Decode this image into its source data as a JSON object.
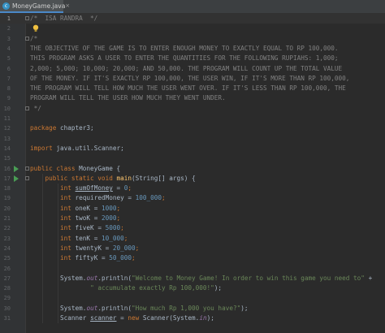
{
  "editor": {
    "tab": {
      "filename": "MoneyGame.java",
      "close": "×"
    },
    "lines": [
      {
        "num": "1",
        "current": true,
        "tokens": [
          {
            "t": "/*  ISA RANDRA  */",
            "c": "comment"
          }
        ]
      },
      {
        "num": "2",
        "bulb": true,
        "tokens": []
      },
      {
        "num": "3",
        "tokens": [
          {
            "t": "/*",
            "c": "comment"
          }
        ]
      },
      {
        "num": "4",
        "tokens": [
          {
            "t": "THE OBJECTIVE OF THE GAME IS TO ENTER ENOUGH MONEY TO EXACTLY EQUAL TO RP 100,000.",
            "c": "comment"
          }
        ]
      },
      {
        "num": "5",
        "tokens": [
          {
            "t": "THIS PROGRAM ASKS A USER TO ENTER THE QUANTITIES FOR THE FOLLOWING RUPIAHS: 1,000;",
            "c": "comment"
          }
        ]
      },
      {
        "num": "6",
        "tokens": [
          {
            "t": "2,000; 5,000; 10,000; 20,000; AND 50,000. THE PROGRAM WILL COUNT UP THE TOTAL VALUE",
            "c": "comment"
          }
        ]
      },
      {
        "num": "7",
        "tokens": [
          {
            "t": "OF THE MONEY. IF IT'S EXACTLY RP 100,000, THE USER WIN, IF IT'S MORE THAN RP 100,000,",
            "c": "comment"
          }
        ]
      },
      {
        "num": "8",
        "tokens": [
          {
            "t": "THE PROGRAM WILL TELL HOW MUCH THE USER WENT OVER. IF IT'S LESS THAN RP 100,000, THE",
            "c": "comment"
          }
        ]
      },
      {
        "num": "9",
        "tokens": [
          {
            "t": "PROGRAM WILL TELL THE USER HOW MUCH THEY WENT UNDER.",
            "c": "comment"
          }
        ]
      },
      {
        "num": "10",
        "tokens": [
          {
            "t": " */",
            "c": "comment"
          }
        ]
      },
      {
        "num": "11",
        "tokens": []
      },
      {
        "num": "12",
        "tokens": [
          {
            "t": "package ",
            "c": "kw"
          },
          {
            "t": "chapter3;",
            "c": "plain"
          }
        ]
      },
      {
        "num": "13",
        "tokens": []
      },
      {
        "num": "14",
        "tokens": [
          {
            "t": "import ",
            "c": "kw"
          },
          {
            "t": "java.util.Scanner;",
            "c": "plain"
          }
        ]
      },
      {
        "num": "15",
        "tokens": []
      },
      {
        "num": "16",
        "run": true,
        "tokens": [
          {
            "t": "public class ",
            "c": "kw"
          },
          {
            "t": "MoneyGame {",
            "c": "plain"
          }
        ]
      },
      {
        "num": "17",
        "run": true,
        "tokens": [
          {
            "t": "    public static void ",
            "c": "kw"
          },
          {
            "t": "main",
            "c": "method"
          },
          {
            "t": "(String[] args) {",
            "c": "plain"
          }
        ]
      },
      {
        "num": "18",
        "tokens": [
          {
            "t": "        int ",
            "c": "kw"
          },
          {
            "t": "sumOfMoney",
            "c": "var"
          },
          {
            "t": " = ",
            "c": "plain"
          },
          {
            "t": "0",
            "c": "num"
          },
          {
            "t": ";",
            "c": "kw"
          }
        ]
      },
      {
        "num": "19",
        "tokens": [
          {
            "t": "        int ",
            "c": "kw"
          },
          {
            "t": "requiredMoney = ",
            "c": "plain"
          },
          {
            "t": "100_000",
            "c": "num"
          },
          {
            "t": ";",
            "c": "kw"
          }
        ]
      },
      {
        "num": "20",
        "tokens": [
          {
            "t": "        int ",
            "c": "kw"
          },
          {
            "t": "oneK = ",
            "c": "plain"
          },
          {
            "t": "1000",
            "c": "num"
          },
          {
            "t": ";",
            "c": "kw"
          }
        ]
      },
      {
        "num": "21",
        "tokens": [
          {
            "t": "        int ",
            "c": "kw"
          },
          {
            "t": "twoK = ",
            "c": "plain"
          },
          {
            "t": "2000",
            "c": "num"
          },
          {
            "t": ";",
            "c": "kw"
          }
        ]
      },
      {
        "num": "22",
        "tokens": [
          {
            "t": "        int ",
            "c": "kw"
          },
          {
            "t": "fiveK = ",
            "c": "plain"
          },
          {
            "t": "5000",
            "c": "num"
          },
          {
            "t": ";",
            "c": "kw"
          }
        ]
      },
      {
        "num": "23",
        "tokens": [
          {
            "t": "        int ",
            "c": "kw"
          },
          {
            "t": "tenK = ",
            "c": "plain"
          },
          {
            "t": "10_000",
            "c": "num"
          },
          {
            "t": ";",
            "c": "kw"
          }
        ]
      },
      {
        "num": "24",
        "tokens": [
          {
            "t": "        int ",
            "c": "kw"
          },
          {
            "t": "twentyK = ",
            "c": "plain"
          },
          {
            "t": "20_000",
            "c": "num"
          },
          {
            "t": ";",
            "c": "kw"
          }
        ]
      },
      {
        "num": "25",
        "tokens": [
          {
            "t": "        int ",
            "c": "kw"
          },
          {
            "t": "fiftyK = ",
            "c": "plain"
          },
          {
            "t": "50_000",
            "c": "num"
          },
          {
            "t": ";",
            "c": "kw"
          }
        ]
      },
      {
        "num": "26",
        "tokens": []
      },
      {
        "num": "27",
        "tokens": [
          {
            "t": "        System.",
            "c": "plain"
          },
          {
            "t": "out",
            "c": "field"
          },
          {
            "t": ".println(",
            "c": "plain"
          },
          {
            "t": "\"Welcome to Money Game! In order to win this game you need to\"",
            "c": "str"
          },
          {
            "t": " +",
            "c": "plain"
          }
        ]
      },
      {
        "num": "28",
        "tokens": [
          {
            "t": "                ",
            "c": "plain"
          },
          {
            "t": "\" accumulate exactly Rp 100,000!\"",
            "c": "str"
          },
          {
            "t": ");",
            "c": "plain"
          }
        ]
      },
      {
        "num": "29",
        "tokens": []
      },
      {
        "num": "30",
        "tokens": [
          {
            "t": "        System.",
            "c": "plain"
          },
          {
            "t": "out",
            "c": "field"
          },
          {
            "t": ".println(",
            "c": "plain"
          },
          {
            "t": "\"How much Rp 1,000 you have?\"",
            "c": "str"
          },
          {
            "t": ");",
            "c": "plain"
          }
        ]
      },
      {
        "num": "31",
        "tokens": [
          {
            "t": "        Scanner ",
            "c": "plain"
          },
          {
            "t": "scanner",
            "c": "var"
          },
          {
            "t": " = ",
            "c": "plain"
          },
          {
            "t": "new ",
            "c": "kw"
          },
          {
            "t": "Scanner(System.",
            "c": "plain"
          },
          {
            "t": "in",
            "c": "field"
          },
          {
            "t": ");",
            "c": "plain"
          }
        ]
      }
    ]
  },
  "colors": {
    "background": "#2b2b2b",
    "comment": "#808080",
    "keyword": "#cc7832",
    "number": "#6897bb",
    "string": "#6a8759",
    "field": "#9876aa",
    "method": "#ffc66d",
    "plain": "#a9b7c6"
  }
}
